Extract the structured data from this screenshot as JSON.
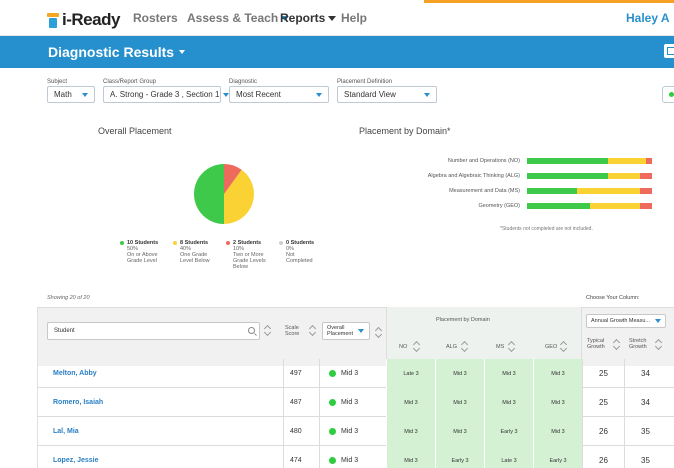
{
  "nav": {
    "logo_text": "i-Ready",
    "items": [
      {
        "label": "Rosters"
      },
      {
        "label": "Assess & Teach"
      },
      {
        "label": "Reports"
      },
      {
        "label": "Help"
      }
    ],
    "user_name": "Haley A"
  },
  "header": {
    "title": "Diagnostic Results"
  },
  "filters": {
    "subject": {
      "label": "Subject",
      "value": "Math"
    },
    "class_group": {
      "label": "Class/Report Group",
      "value": "A. Strong - Grade 3 , Section 1"
    },
    "diagnostic": {
      "label": "Diagnostic",
      "value": "Most Recent"
    },
    "placement_definition": {
      "label": "Placement Definition",
      "value": "Standard View"
    }
  },
  "overall_placement": {
    "title": "Overall Placement",
    "legend": [
      {
        "count": "10 Students",
        "pct": "50%",
        "desc1": "On or Above",
        "desc2": "Grade Level",
        "desc3": "",
        "color": "#3fc94a"
      },
      {
        "count": "8 Students",
        "pct": "40%",
        "desc1": "One Grade",
        "desc2": "Level Below",
        "desc3": "",
        "color": "#fbd234"
      },
      {
        "count": "2 Students",
        "pct": "10%",
        "desc1": "Two or More",
        "desc2": "Grade Levels",
        "desc3": "Below",
        "color": "#ee6a5c"
      },
      {
        "count": "0 Students",
        "pct": "0%",
        "desc1": "Not",
        "desc2": "Completed",
        "desc3": "",
        "color": "#cfcfcf"
      }
    ]
  },
  "placement_by_domain": {
    "title": "Placement by Domain*",
    "domains": [
      {
        "label": "Number and Operations (NO)",
        "green": 0.65,
        "yellow": 0.3,
        "red": 0.05
      },
      {
        "label": "Algebra and Algebraic Thinking (ALG)",
        "green": 0.65,
        "yellow": 0.25,
        "red": 0.1
      },
      {
        "label": "Measurement and Data (MS)",
        "green": 0.4,
        "yellow": 0.5,
        "red": 0.1
      },
      {
        "label": "Geometry (GEO)",
        "green": 0.5,
        "yellow": 0.4,
        "red": 0.1
      }
    ],
    "footnote": "*Students not completed are not included."
  },
  "table": {
    "showing": "Showing 20 of 20",
    "choose_column_label": "Choose Your Column:",
    "student_placeholder": "Student",
    "scale_score_header": "Scale Score",
    "overall_placement_header": "Overall Placement",
    "placement_by_domain_header": "Placement by Domain",
    "domain_headers": [
      "NO",
      "ALG",
      "MS",
      "GEO"
    ],
    "column_select": "Annual Growth Measu...",
    "typical_growth_header": "Typical Growth",
    "stretch_growth_header": "Stretch Growth",
    "rows": [
      {
        "name": "Melton, Abby",
        "score": "497",
        "placement": "Mid 3",
        "domains": [
          "Late 3",
          "Mid 3",
          "Mid 3",
          "Mid 3"
        ],
        "typical": "25",
        "stretch": "34"
      },
      {
        "name": "Romero, Isaiah",
        "score": "487",
        "placement": "Mid 3",
        "domains": [
          "Mid 3",
          "Mid 3",
          "Mid 3",
          "Mid 3"
        ],
        "typical": "25",
        "stretch": "34"
      },
      {
        "name": "Lal, Mia",
        "score": "480",
        "placement": "Mid 3",
        "domains": [
          "Mid 3",
          "Mid 3",
          "Early 3",
          "Mid 3"
        ],
        "typical": "26",
        "stretch": "35"
      },
      {
        "name": "Lopez, Jessie",
        "score": "474",
        "placement": "Mid 3",
        "domains": [
          "Mid 3",
          "Early 3",
          "Late 3",
          "Early 3"
        ],
        "typical": "26",
        "stretch": "35"
      }
    ]
  },
  "colors": {
    "accent": "#2690cf",
    "green": "#3fc94a",
    "yellow": "#fbd234",
    "red": "#ee6a5c",
    "domain_cell": "#d4f1d3"
  }
}
